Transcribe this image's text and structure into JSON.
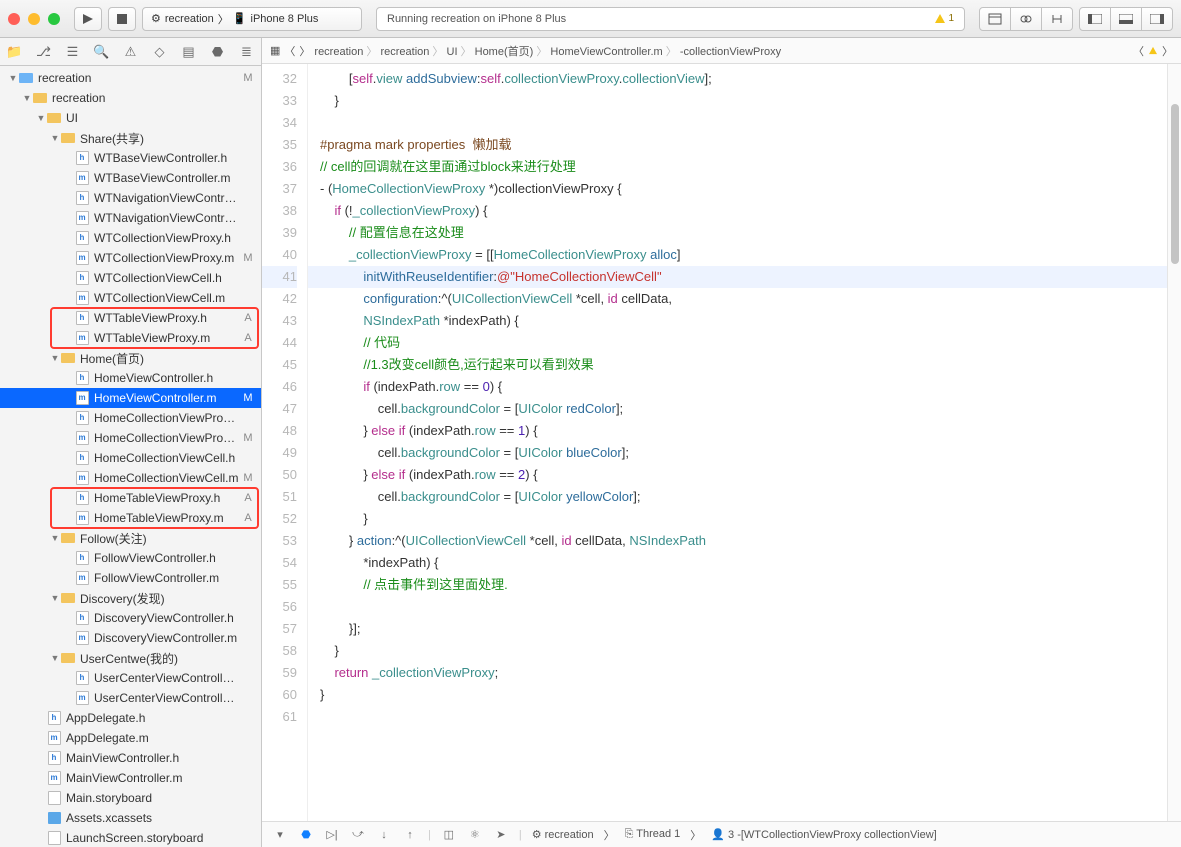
{
  "toolbar": {
    "scheme_app": "recreation",
    "scheme_device": "iPhone 8 Plus",
    "status": "Running recreation on iPhone 8 Plus",
    "warn_count": "1"
  },
  "breadcrumb": [
    "recreation",
    "recreation",
    "UI",
    "Home(首页)",
    "HomeViewController.m",
    "-collectionViewProxy"
  ],
  "tree": [
    {
      "d": 0,
      "t": "proj",
      "n": "recreation",
      "b": "M",
      "exp": 1
    },
    {
      "d": 1,
      "t": "fy",
      "n": "recreation",
      "exp": 1
    },
    {
      "d": 2,
      "t": "fy",
      "n": "UI",
      "exp": 1
    },
    {
      "d": 3,
      "t": "fy",
      "n": "Share(共享)",
      "exp": 1
    },
    {
      "d": 4,
      "t": "h",
      "n": "WTBaseViewController.h"
    },
    {
      "d": 4,
      "t": "m",
      "n": "WTBaseViewController.m"
    },
    {
      "d": 4,
      "t": "h",
      "n": "WTNavigationViewController.h"
    },
    {
      "d": 4,
      "t": "m",
      "n": "WTNavigationViewController.m"
    },
    {
      "d": 4,
      "t": "h",
      "n": "WTCollectionViewProxy.h"
    },
    {
      "d": 4,
      "t": "m",
      "n": "WTCollectionViewProxy.m",
      "b": "M"
    },
    {
      "d": 4,
      "t": "h",
      "n": "WTCollectionViewCell.h"
    },
    {
      "d": 4,
      "t": "m",
      "n": "WTCollectionViewCell.m"
    },
    {
      "d": 4,
      "t": "h",
      "n": "WTTableViewProxy.h",
      "b": "A"
    },
    {
      "d": 4,
      "t": "m",
      "n": "WTTableViewProxy.m",
      "b": "A"
    },
    {
      "d": 3,
      "t": "fy",
      "n": "Home(首页)",
      "exp": 1
    },
    {
      "d": 4,
      "t": "h",
      "n": "HomeViewController.h"
    },
    {
      "d": 4,
      "t": "m",
      "n": "HomeViewController.m",
      "b": "M",
      "sel": 1
    },
    {
      "d": 4,
      "t": "h",
      "n": "HomeCollectionViewProxy.h"
    },
    {
      "d": 4,
      "t": "m",
      "n": "HomeCollectionViewProxy.m",
      "b": "M"
    },
    {
      "d": 4,
      "t": "h",
      "n": "HomeCollectionViewCell.h"
    },
    {
      "d": 4,
      "t": "m",
      "n": "HomeCollectionViewCell.m",
      "b": "M"
    },
    {
      "d": 4,
      "t": "h",
      "n": "HomeTableViewProxy.h",
      "b": "A"
    },
    {
      "d": 4,
      "t": "m",
      "n": "HomeTableViewProxy.m",
      "b": "A"
    },
    {
      "d": 3,
      "t": "fy",
      "n": "Follow(关注)",
      "exp": 1
    },
    {
      "d": 4,
      "t": "h",
      "n": "FollowViewController.h"
    },
    {
      "d": 4,
      "t": "m",
      "n": "FollowViewController.m"
    },
    {
      "d": 3,
      "t": "fy",
      "n": "Discovery(发现)",
      "exp": 1
    },
    {
      "d": 4,
      "t": "h",
      "n": "DiscoveryViewController.h"
    },
    {
      "d": 4,
      "t": "m",
      "n": "DiscoveryViewController.m"
    },
    {
      "d": 3,
      "t": "fy",
      "n": "UserCentwe(我的)",
      "exp": 1
    },
    {
      "d": 4,
      "t": "h",
      "n": "UserCenterViewController.h"
    },
    {
      "d": 4,
      "t": "m",
      "n": "UserCenterViewController.m"
    },
    {
      "d": 2,
      "t": "h",
      "n": "AppDelegate.h"
    },
    {
      "d": 2,
      "t": "m",
      "n": "AppDelegate.m"
    },
    {
      "d": 2,
      "t": "h",
      "n": "MainViewController.h"
    },
    {
      "d": 2,
      "t": "m",
      "n": "MainViewController.m"
    },
    {
      "d": 2,
      "t": "sb",
      "n": "Main.storyboard"
    },
    {
      "d": 2,
      "t": "xc",
      "n": "Assets.xcassets"
    },
    {
      "d": 2,
      "t": "sb",
      "n": "LaunchScreen.storyboard"
    }
  ],
  "code": {
    "start": 32,
    "current": 41,
    "lines": [
      {
        "h": "        [<span class='kw'>self</span>.<span class='idv'>view</span> <span class='mth'>addSubview</span>:<span class='kw'>self</span>.<span class='idv'>collectionViewProxy</span>.<span class='idv'>collectionView</span>];"
      },
      {
        "h": "    }"
      },
      {
        "h": ""
      },
      {
        "h": "<span class='pr'>#pragma mark properties  懒加载</span>"
      },
      {
        "h": "<span class='cm'>// cell的回调就在这里面通过block来进行处理</span>"
      },
      {
        "h": "- (<span class='ty'>HomeCollectionViewProxy</span> *)collectionViewProxy {"
      },
      {
        "h": "    <span class='kw'>if</span> (!<span class='idv'>_collectionViewProxy</span>) {"
      },
      {
        "h": "        <span class='cm'>// 配置信息在这处理</span>"
      },
      {
        "h": "        <span class='idv'>_collectionViewProxy</span> = [[<span class='ty'>HomeCollectionViewProxy</span> <span class='mth'>alloc</span>]"
      },
      {
        "h": "            <span class='mth'>initWithReuseIdentifier</span>:<span class='str'>@\"HomeCollectionViewCell\"</span>"
      },
      {
        "h": "            <span class='mth'>configuration</span>:^(<span class='ty'>UICollectionViewCell</span> *cell, <span class='kw'>id</span> cellData,"
      },
      {
        "h": "            <span class='ty'>NSIndexPath</span> *indexPath) {"
      },
      {
        "h": "            <span class='cm'>// 代码</span>"
      },
      {
        "h": "            <span class='cm'>//1.3改变cell颜色,运行起来可以看到效果</span>"
      },
      {
        "h": "            <span class='kw'>if</span> (indexPath.<span class='idv'>row</span> == <span class='num'>0</span>) {"
      },
      {
        "h": "                cell.<span class='idv'>backgroundColor</span> = [<span class='ty'>UIColor</span> <span class='mth'>redColor</span>];"
      },
      {
        "h": "            } <span class='kw'>else if</span> (indexPath.<span class='idv'>row</span> == <span class='num'>1</span>) {"
      },
      {
        "h": "                cell.<span class='idv'>backgroundColor</span> = [<span class='ty'>UIColor</span> <span class='mth'>blueColor</span>];"
      },
      {
        "h": "            } <span class='kw'>else if</span> (indexPath.<span class='idv'>row</span> == <span class='num'>2</span>) {"
      },
      {
        "h": "                cell.<span class='idv'>backgroundColor</span> = [<span class='ty'>UIColor</span> <span class='mth'>yellowColor</span>];"
      },
      {
        "h": "            }"
      },
      {
        "h": "        } <span class='mth'>action</span>:^(<span class='ty'>UICollectionViewCell</span> *cell, <span class='kw'>id</span> cellData, <span class='ty'>NSIndexPath</span>"
      },
      {
        "h": "            *indexPath) {"
      },
      {
        "h": "            <span class='cm'>// 点击事件到这里面处理.</span>"
      },
      {
        "h": ""
      },
      {
        "h": "        }];"
      },
      {
        "h": "    }"
      },
      {
        "h": "    <span class='kw'>return</span> <span class='idv'>_collectionViewProxy</span>;"
      },
      {
        "h": "}"
      },
      {
        "h": ""
      }
    ]
  },
  "debug": {
    "process": "recreation",
    "thread": "Thread 1",
    "frame": "3 -[WTCollectionViewProxy collectionView]"
  }
}
